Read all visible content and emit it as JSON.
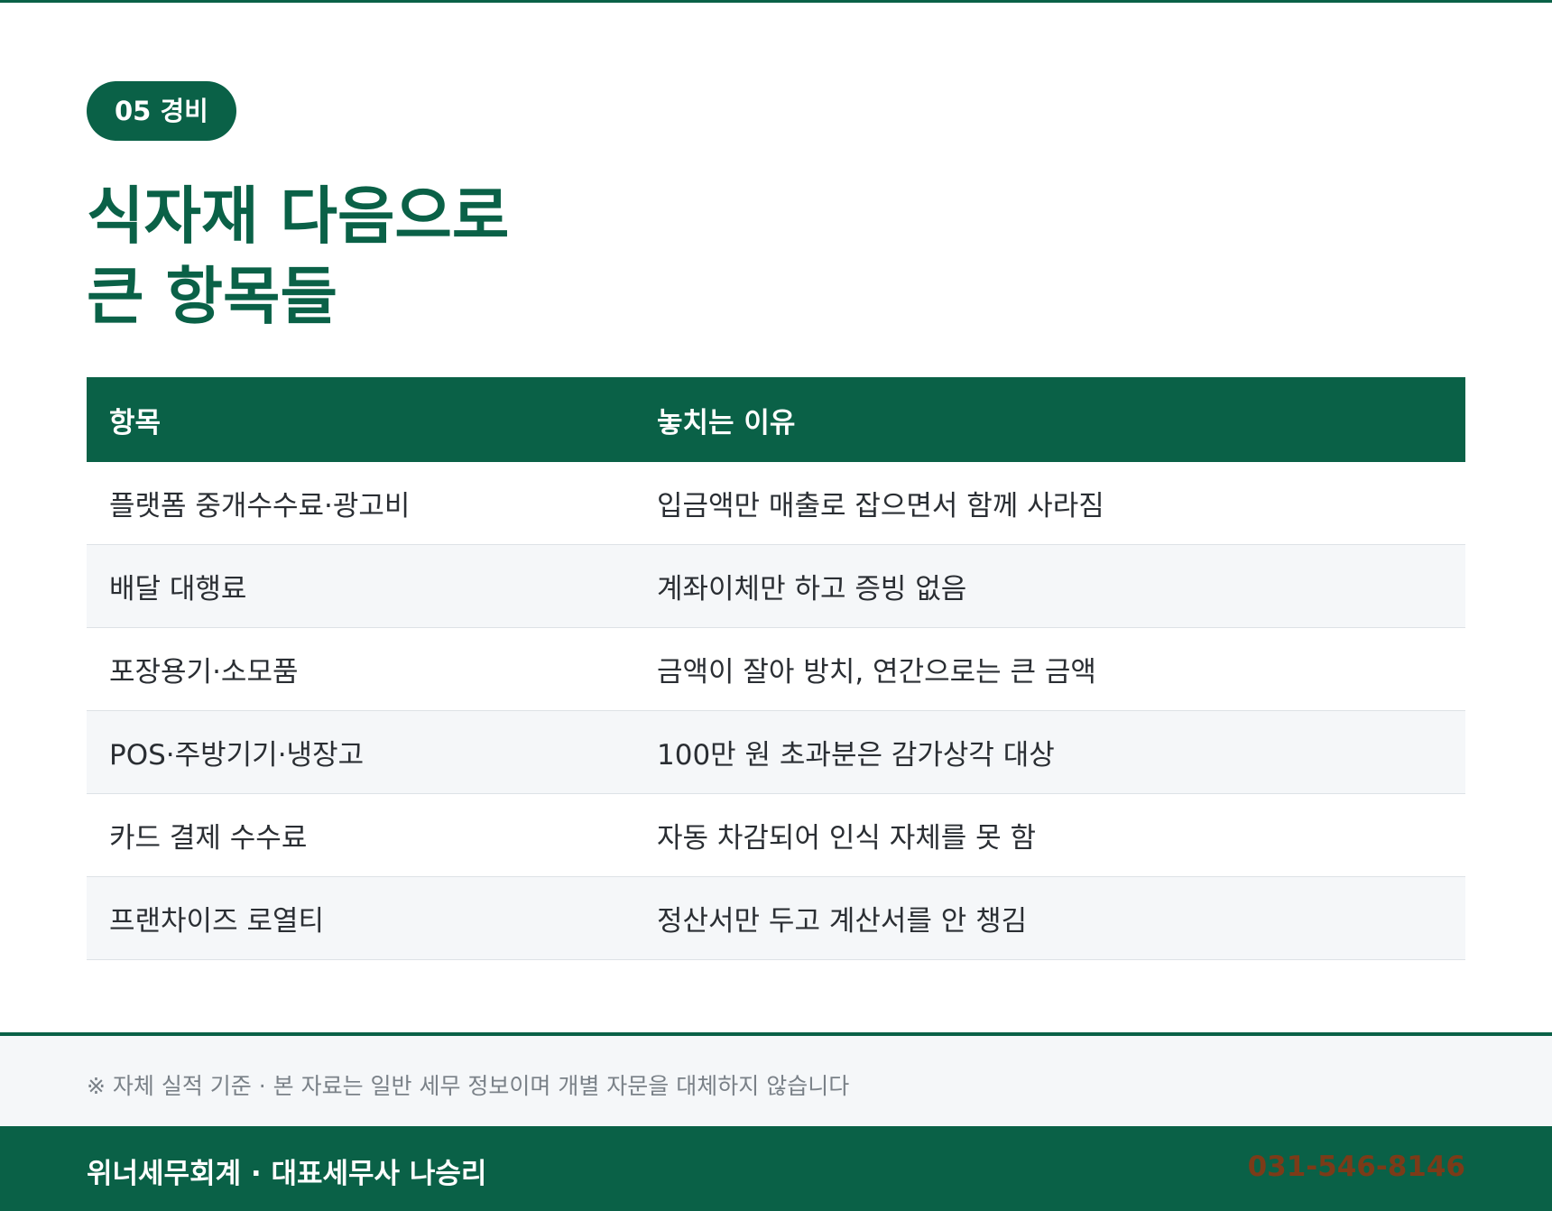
{
  "section_badge": "05 경비",
  "title": {
    "line1": "식자재 다음으로",
    "line2": "큰 항목들"
  },
  "table": {
    "headers": [
      "항목",
      "놓치는 이유"
    ],
    "rows": [
      [
        "플랫폼 중개수수료·광고비",
        "입금액만 매출로 잡으면서 함께 사라짐"
      ],
      [
        "배달 대행료",
        "계좌이체만 하고 증빙 없음"
      ],
      [
        "포장용기·소모품",
        "금액이 잘아 방치, 연간으로는 큰 금액"
      ],
      [
        "POS·주방기기·냉장고",
        "100만 원 초과분은 감가상각 대상"
      ],
      [
        "카드 결제 수수료",
        "자동 차감되어 인식 자체를 못 함"
      ],
      [
        "프랜차이즈 로열티",
        "정산서만 두고 계산서를 안 챙김"
      ]
    ]
  },
  "notice": "※ 자체 실적 기준 · 본 자료는 일반 세무 정보이며 개별 자문을 대체하지 않습니다",
  "footer": {
    "firm": "위너세무회계 · 대표세무사 나승리",
    "phone": "031-546-8146"
  },
  "colors": {
    "brand_green": "#0a6147",
    "phone_text": "#7c3b18",
    "row_alt": "#f5f7f9"
  }
}
